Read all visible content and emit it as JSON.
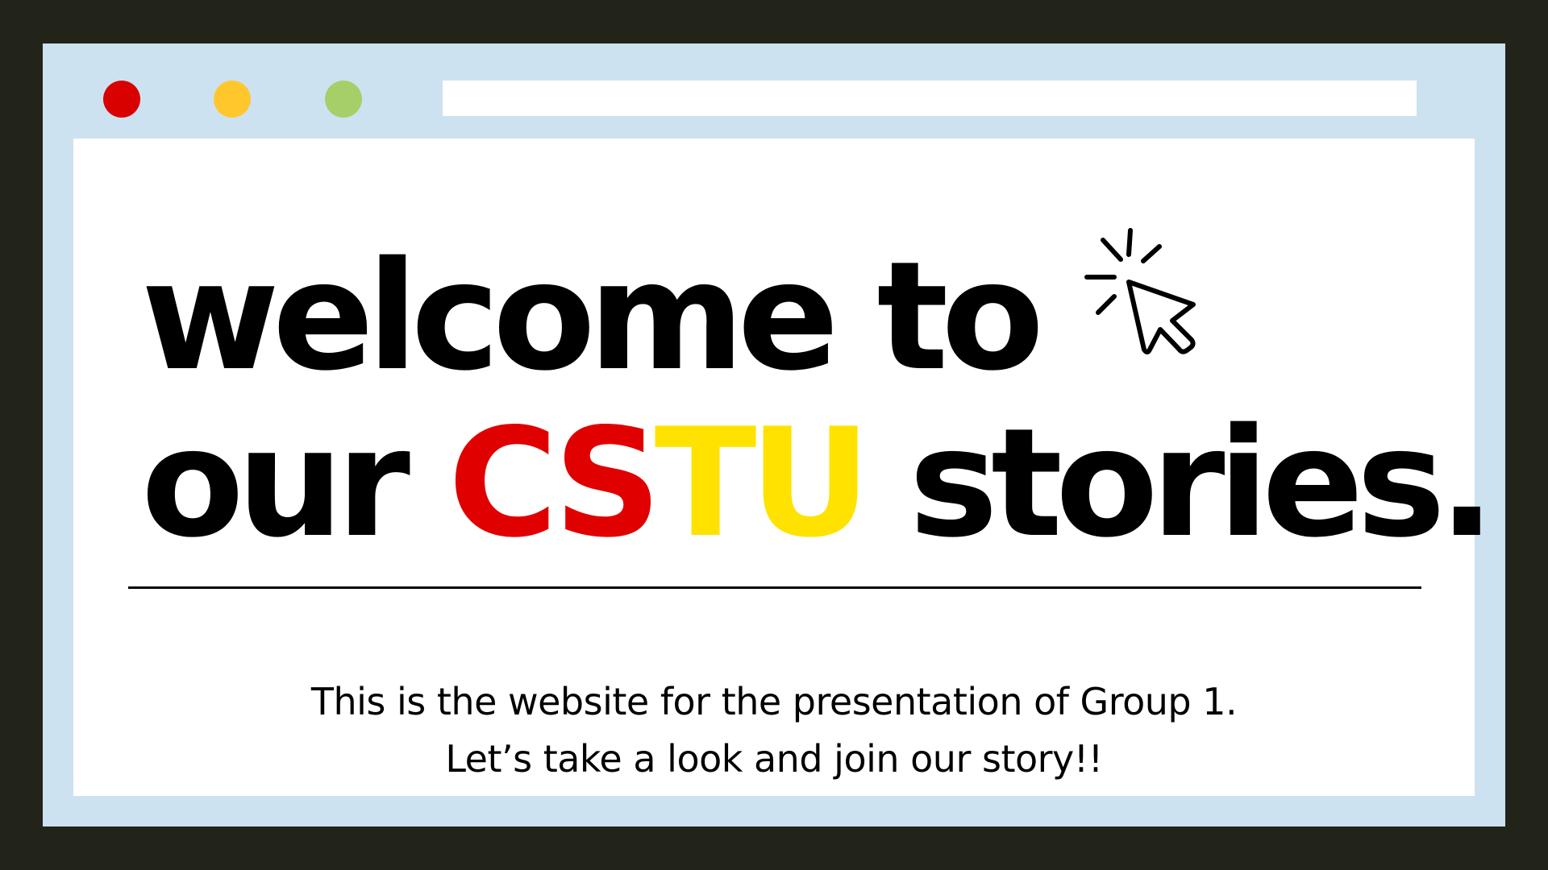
{
  "window": {
    "controls": {
      "close_color": "#d90000",
      "minimize_color": "#ffc72c",
      "maximize_color": "#a6cf69"
    },
    "address_bar": {
      "value": ""
    }
  },
  "headline": {
    "line1": "welcome to",
    "line2_prefix": "our",
    "brand": {
      "c": "C",
      "s": "S",
      "t": "T",
      "u": "U"
    },
    "line2_suffix": "stories.",
    "brand_colors": {
      "red": "#e00000",
      "yellow": "#ffe200"
    }
  },
  "icons": {
    "cursor": "cursor-click-icon"
  },
  "subtitle": {
    "line1": "This is the website for the presentation of Group 1.",
    "line2": "Let’s take a look and join our story!!"
  },
  "colors": {
    "background": "#222419",
    "frame": "#cde2f0",
    "content": "#ffffff"
  }
}
